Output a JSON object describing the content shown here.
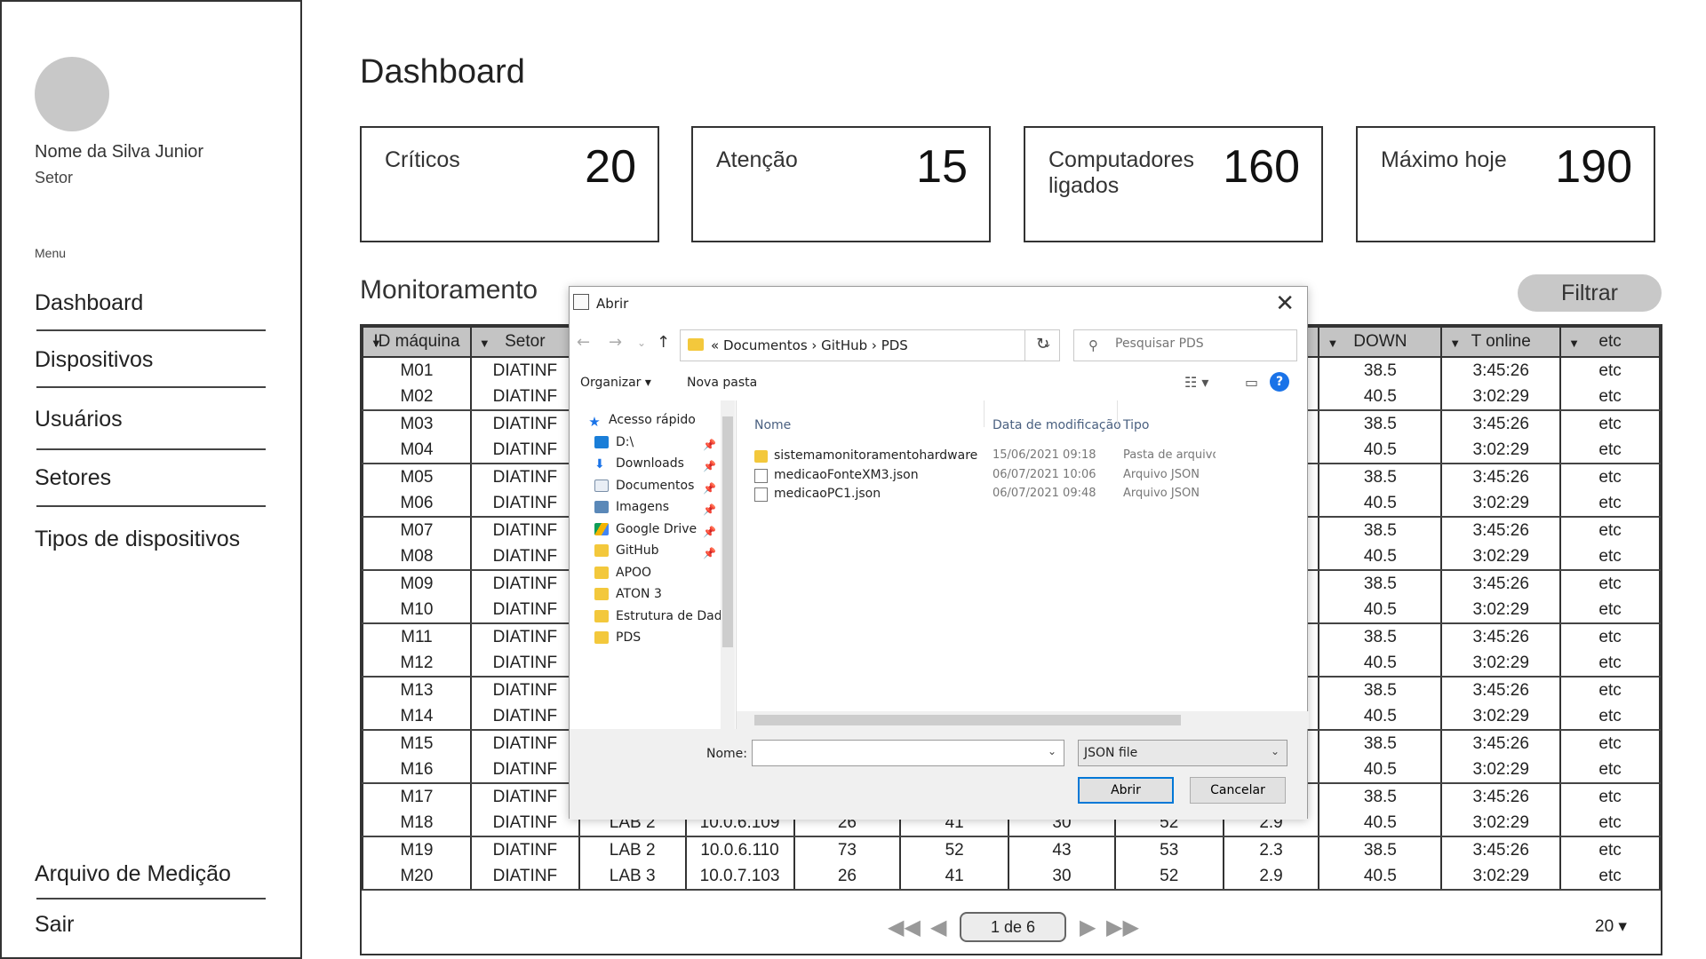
{
  "sidebar": {
    "user_name": "Nome da Silva Junior",
    "user_sector": "Setor",
    "menu_label": "Menu",
    "items": [
      {
        "label": "Dashboard"
      },
      {
        "label": "Dispositivos"
      },
      {
        "label": "Usuários"
      },
      {
        "label": "Setores"
      },
      {
        "label": "Tipos de dispositivos"
      }
    ],
    "bottom_items": [
      {
        "label": "Arquivo de Medição"
      },
      {
        "label": "Sair"
      }
    ]
  },
  "page": {
    "title": "Dashboard",
    "cards": [
      {
        "label": "Críticos",
        "value": "20"
      },
      {
        "label": "Atenção",
        "value": "15"
      },
      {
        "label": "Computadores ligados",
        "value": "160"
      },
      {
        "label": "Máximo hoje",
        "value": "190"
      }
    ],
    "section_title": "Monitoramento",
    "filter_label": "Filtrar"
  },
  "table": {
    "headers": [
      "ID máquina",
      "Setor",
      "",
      "",
      "",
      "",
      "",
      "",
      "",
      "DOWN",
      "T online",
      "etc"
    ],
    "rows": [
      [
        "M01",
        "DIATINF",
        "",
        "",
        "",
        "",
        "",
        "",
        "",
        "38.5",
        "3:45:26",
        "etc"
      ],
      [
        "M02",
        "DIATINF",
        "",
        "",
        "",
        "",
        "",
        "",
        "",
        "40.5",
        "3:02:29",
        "etc"
      ],
      [
        "M03",
        "DIATINF",
        "",
        "",
        "",
        "",
        "",
        "",
        "",
        "38.5",
        "3:45:26",
        "etc"
      ],
      [
        "M04",
        "DIATINF",
        "",
        "",
        "",
        "",
        "",
        "",
        "",
        "40.5",
        "3:02:29",
        "etc"
      ],
      [
        "M05",
        "DIATINF",
        "",
        "",
        "",
        "",
        "",
        "",
        "",
        "38.5",
        "3:45:26",
        "etc"
      ],
      [
        "M06",
        "DIATINF",
        "",
        "",
        "",
        "",
        "",
        "",
        "",
        "40.5",
        "3:02:29",
        "etc"
      ],
      [
        "M07",
        "DIATINF",
        "",
        "",
        "",
        "",
        "",
        "",
        "",
        "38.5",
        "3:45:26",
        "etc"
      ],
      [
        "M08",
        "DIATINF",
        "",
        "",
        "",
        "",
        "",
        "",
        "",
        "40.5",
        "3:02:29",
        "etc"
      ],
      [
        "M09",
        "DIATINF",
        "",
        "",
        "",
        "",
        "",
        "",
        "",
        "38.5",
        "3:45:26",
        "etc"
      ],
      [
        "M10",
        "DIATINF",
        "",
        "",
        "",
        "",
        "",
        "",
        "",
        "40.5",
        "3:02:29",
        "etc"
      ],
      [
        "M11",
        "DIATINF",
        "",
        "",
        "",
        "",
        "",
        "",
        "",
        "38.5",
        "3:45:26",
        "etc"
      ],
      [
        "M12",
        "DIATINF",
        "",
        "",
        "",
        "",
        "",
        "",
        "",
        "40.5",
        "3:02:29",
        "etc"
      ],
      [
        "M13",
        "DIATINF",
        "",
        "",
        "",
        "",
        "",
        "",
        "",
        "38.5",
        "3:45:26",
        "etc"
      ],
      [
        "M14",
        "DIATINF",
        "",
        "",
        "",
        "",
        "",
        "",
        "",
        "40.5",
        "3:02:29",
        "etc"
      ],
      [
        "M15",
        "DIATINF",
        "",
        "",
        "",
        "",
        "",
        "",
        "",
        "38.5",
        "3:45:26",
        "etc"
      ],
      [
        "M16",
        "DIATINF",
        "",
        "",
        "",
        "",
        "",
        "",
        "",
        "40.5",
        "3:02:29",
        "etc"
      ],
      [
        "M17",
        "DIATINF",
        "",
        "",
        "",
        "",
        "",
        "",
        "",
        "38.5",
        "3:45:26",
        "etc"
      ],
      [
        "M18",
        "DIATINF",
        "LAB 2",
        "10.0.6.109",
        "26",
        "41",
        "30",
        "52",
        "2.9",
        "40.5",
        "3:02:29",
        "etc"
      ],
      [
        "M19",
        "DIATINF",
        "LAB 2",
        "10.0.6.110",
        "73",
        "52",
        "43",
        "53",
        "2.3",
        "38.5",
        "3:45:26",
        "etc"
      ],
      [
        "M20",
        "DIATINF",
        "LAB 3",
        "10.0.7.103",
        "26",
        "41",
        "30",
        "52",
        "2.9",
        "40.5",
        "3:02:29",
        "etc"
      ]
    ],
    "pager": {
      "current": "1 de 6",
      "page_size": "20 ▾"
    }
  },
  "dialog": {
    "title": "Abrir",
    "breadcrumb": "«  Documentos  ›  GitHub  ›  PDS",
    "search_placeholder": "Pesquisar PDS",
    "organize": "Organizar ▾",
    "new_folder": "Nova pasta",
    "nav_items": [
      {
        "label": "Acesso rápido",
        "icon": "star"
      },
      {
        "label": "D:\\",
        "icon": "drive"
      },
      {
        "label": "Downloads",
        "icon": "dl"
      },
      {
        "label": "Documentos",
        "icon": "doc"
      },
      {
        "label": "Imagens",
        "icon": "img"
      },
      {
        "label": "Google Drive",
        "icon": "gd"
      },
      {
        "label": "GitHub",
        "icon": "folder"
      },
      {
        "label": "APOO",
        "icon": "folder"
      },
      {
        "label": "ATON 3",
        "icon": "folder"
      },
      {
        "label": "Estrutura de Dad",
        "icon": "folder"
      },
      {
        "label": "PDS",
        "icon": "folder"
      }
    ],
    "columns": {
      "name": "Nome",
      "date": "Data de modificação",
      "type": "Tipo"
    },
    "files": [
      {
        "name": "sistemamonitoramentohardware",
        "date": "15/06/2021 09:18",
        "type": "Pasta de arquivos",
        "kind": "folder"
      },
      {
        "name": "medicaoFonteXM3.json",
        "date": "06/07/2021 10:06",
        "type": "Arquivo JSON",
        "kind": "file"
      },
      {
        "name": "medicaoPC1.json",
        "date": "06/07/2021 09:48",
        "type": "Arquivo JSON",
        "kind": "file"
      }
    ],
    "name_label": "Nome:",
    "name_value": "",
    "filetype": "JSON file",
    "open_label": "Abrir",
    "cancel_label": "Cancelar"
  }
}
